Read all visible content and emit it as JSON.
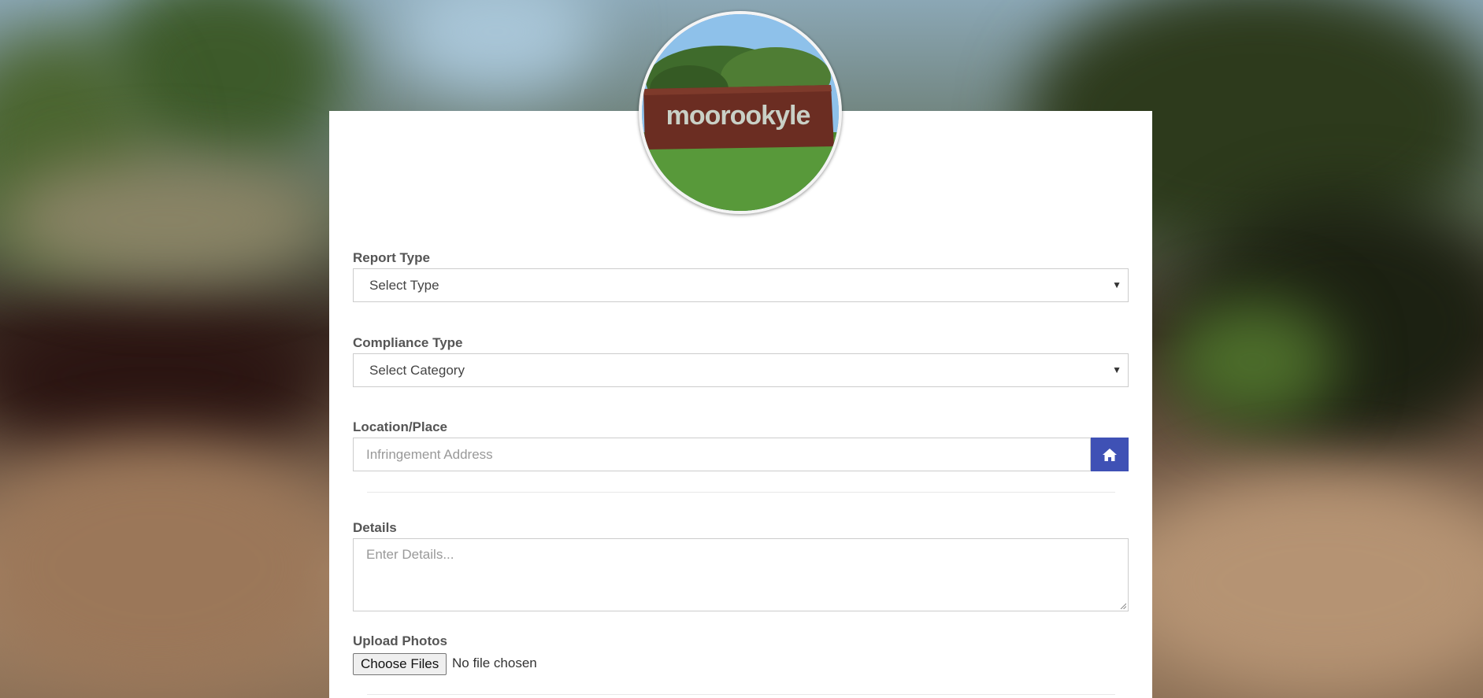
{
  "form": {
    "report_type": {
      "label": "Report Type",
      "selected": "Select Type"
    },
    "compliance_type": {
      "label": "Compliance Type",
      "selected": "Select Category"
    },
    "location": {
      "label": "Location/Place",
      "placeholder": "Infringement Address",
      "addon_icon": "home-icon"
    },
    "details": {
      "label": "Details",
      "placeholder": "Enter Details..."
    },
    "upload": {
      "label": "Upload Photos",
      "button_label": "Choose Files",
      "status": "No file chosen"
    }
  },
  "logo": {
    "sign_text": "moorookyle"
  },
  "colors": {
    "accent": "#3f51b5",
    "label": "#555555",
    "border": "#cccccc"
  }
}
